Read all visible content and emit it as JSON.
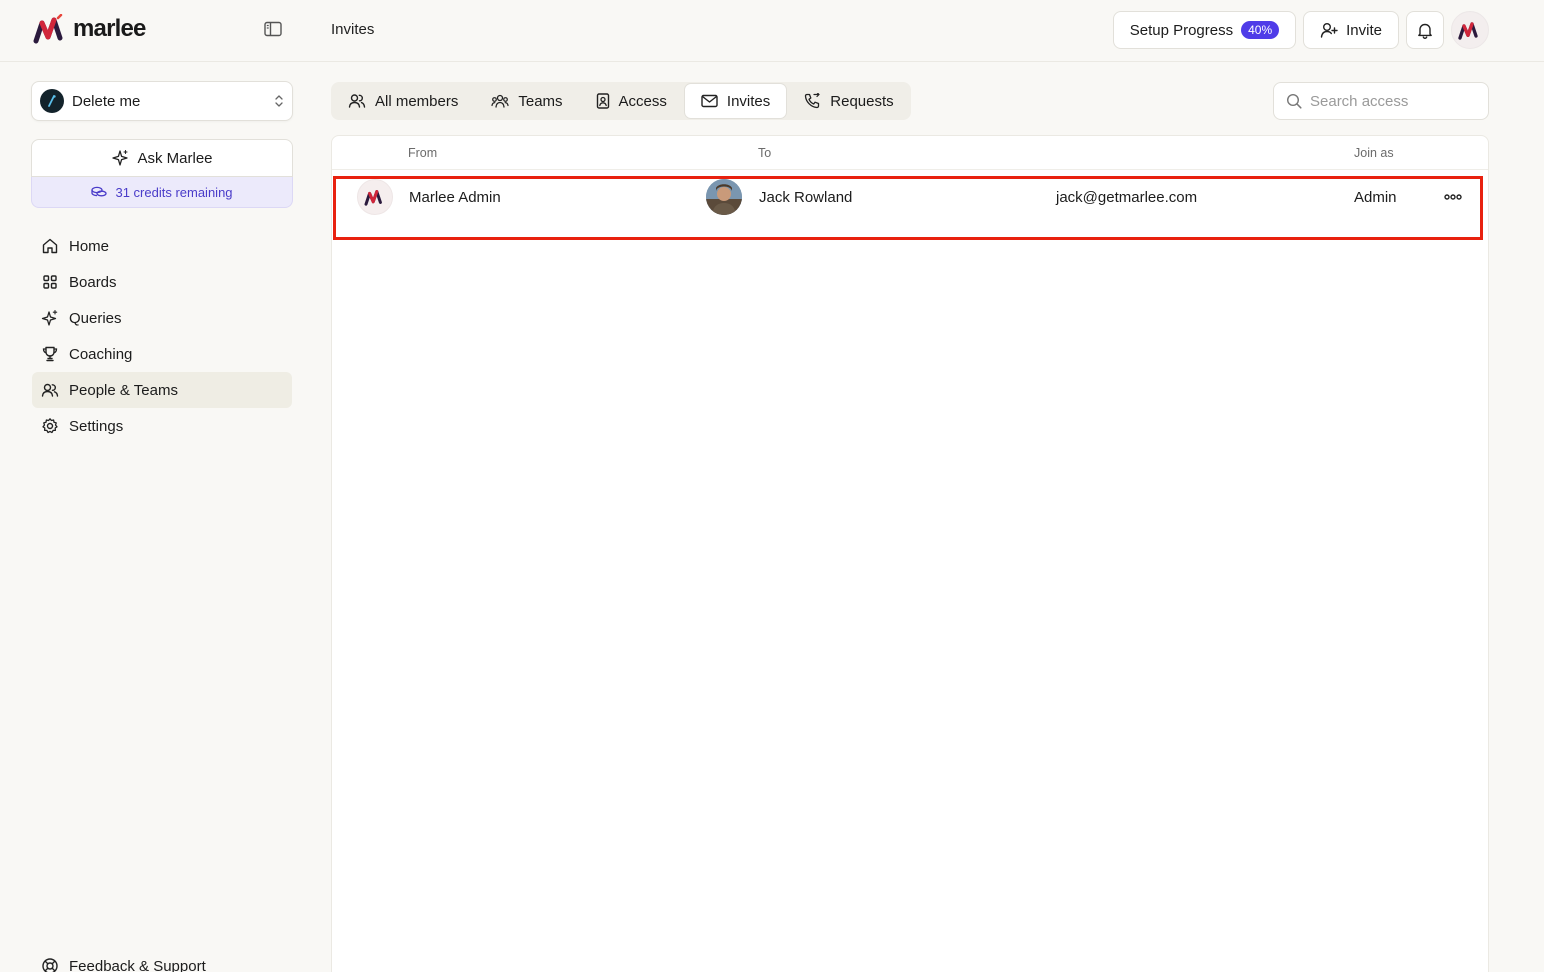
{
  "app": {
    "name": "marlee"
  },
  "header": {
    "title": "Invites",
    "setup_progress_label": "Setup Progress",
    "setup_progress_value": "40%",
    "invite_label": "Invite"
  },
  "workspace": {
    "name": "Delete me"
  },
  "ask": {
    "label": "Ask Marlee",
    "credits": "31 credits remaining"
  },
  "sidebar": {
    "items": [
      {
        "label": "Home",
        "icon": "home-icon"
      },
      {
        "label": "Boards",
        "icon": "grid-icon"
      },
      {
        "label": "Queries",
        "icon": "sparkle-icon"
      },
      {
        "label": "Coaching",
        "icon": "trophy-icon"
      },
      {
        "label": "People & Teams",
        "icon": "people-icon",
        "active": true
      },
      {
        "label": "Settings",
        "icon": "gear-icon"
      }
    ],
    "feedback": "Feedback & Support"
  },
  "tabs": [
    {
      "label": "All members",
      "icon": "users-icon"
    },
    {
      "label": "Teams",
      "icon": "team-icon"
    },
    {
      "label": "Access",
      "icon": "badge-icon"
    },
    {
      "label": "Invites",
      "icon": "mail-icon",
      "active": true
    },
    {
      "label": "Requests",
      "icon": "phone-icon"
    }
  ],
  "search": {
    "placeholder": "Search access",
    "value": ""
  },
  "table": {
    "columns": [
      "From",
      "To",
      "Join as"
    ],
    "rows": [
      {
        "from": "Marlee Admin",
        "to": "Jack Rowland",
        "email": "jack@getmarlee.com",
        "join_as": "Admin"
      }
    ]
  },
  "colors": {
    "accent": "#4f3ce8",
    "brand_red": "#d1263b",
    "highlight": "#e8210f",
    "active_nav": "#efede4"
  }
}
